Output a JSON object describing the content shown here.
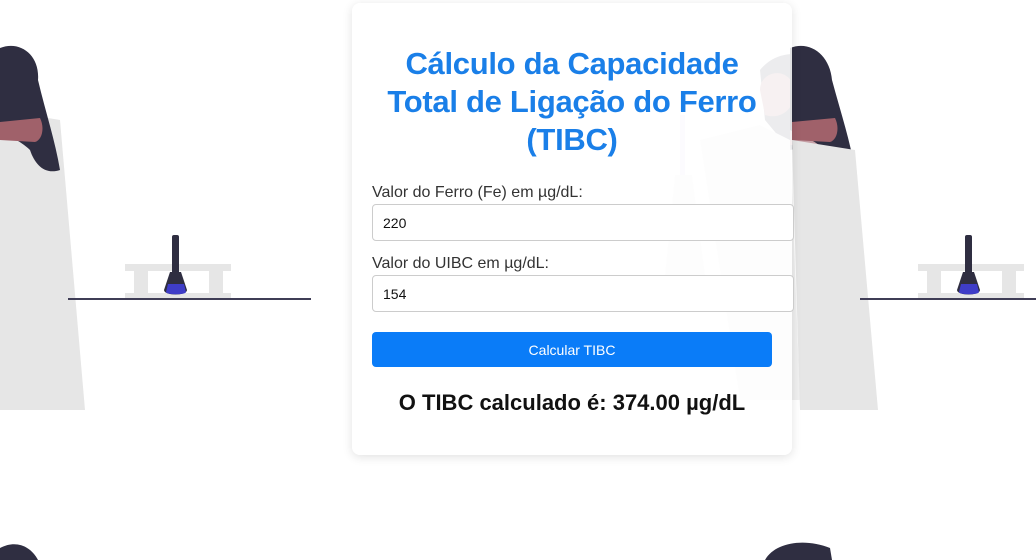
{
  "calculator": {
    "title": "Cálculo da Capacidade Total de Ligação do Ferro (TIBC)",
    "fe_label": "Valor do Ferro (Fe) em µg/dL:",
    "fe_value": "220",
    "uibc_label": "Valor do UIBC em µg/dL:",
    "uibc_value": "154",
    "button_label": "Calcular TIBC",
    "result_text": "O TIBC calculado é: 374.00 µg/dL"
  },
  "colors": {
    "accent": "#1a7fe8",
    "button": "#0a7cf8",
    "illustration_dark": "#2f2e41",
    "flask_liquid": "#3f3dc8"
  },
  "icons": [
    "scientist-illustration",
    "lab-flask-illustration",
    "lab-bench-illustration"
  ]
}
